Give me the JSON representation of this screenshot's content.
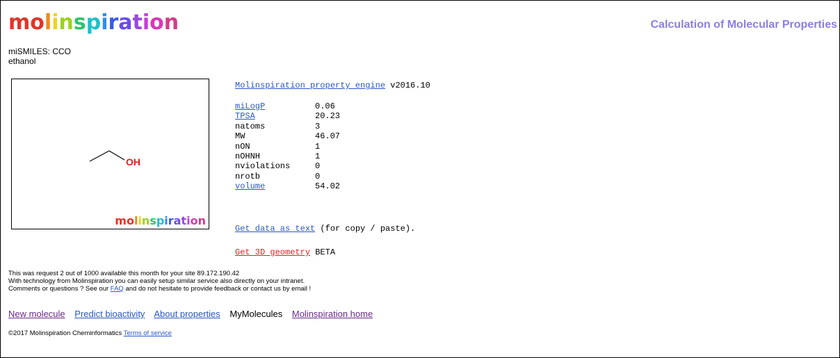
{
  "header": {
    "logo_letters": [
      {
        "ch": "m",
        "color": "#e0352b"
      },
      {
        "ch": "o",
        "color": "#e0352b"
      },
      {
        "ch": "l",
        "color": "#f08a1c"
      },
      {
        "ch": "i",
        "color": "#f2d21a"
      },
      {
        "ch": "n",
        "color": "#9bd31d"
      },
      {
        "ch": "s",
        "color": "#2fc46a"
      },
      {
        "ch": "p",
        "color": "#1fc0c8"
      },
      {
        "ch": "i",
        "color": "#2f8ee6"
      },
      {
        "ch": "r",
        "color": "#3b5be8"
      },
      {
        "ch": "a",
        "color": "#6a4be6"
      },
      {
        "ch": "t",
        "color": "#9a46e0"
      },
      {
        "ch": "i",
        "color": "#c43fd8"
      },
      {
        "ch": "o",
        "color": "#d838b8"
      },
      {
        "ch": "n",
        "color": "#d63a8a"
      }
    ],
    "page_heading": "Calculation of Molecular Properties",
    "heading_color": "#8a7fe6"
  },
  "molecule": {
    "smiles_line": "miSMILES: CCO",
    "name": "ethanol",
    "atom_label": "OH",
    "atom_color": "#e02020",
    "watermark": "molinspiration"
  },
  "engine": {
    "link": "Molinspiration property engine",
    "version": "v2016.10"
  },
  "properties": [
    {
      "name": "miLogP",
      "value": "0.06",
      "link": true
    },
    {
      "name": "TPSA",
      "value": "20.23",
      "link": true
    },
    {
      "name": "natoms",
      "value": "3",
      "link": false
    },
    {
      "name": "MW",
      "value": "46.07",
      "link": false
    },
    {
      "name": "nON",
      "value": "1",
      "link": false
    },
    {
      "name": "nOHNH",
      "value": "1",
      "link": false
    },
    {
      "name": "nviolations",
      "value": "0",
      "link": false
    },
    {
      "name": "nrotb",
      "value": "0",
      "link": false
    },
    {
      "name": "volume",
      "value": "54.02",
      "link": true
    }
  ],
  "actions": {
    "text_link": "Get data as text",
    "text_suffix": " (for copy / paste).",
    "geom_link": "Get 3D geometry",
    "geom_suffix": " BETA"
  },
  "info": {
    "line1": "This was request 2 out of 1000 available this month for your site 89.172.190.42",
    "line2": "With technology from Molinspiration you can easily setup similar service also directly on your intranet.",
    "line3_pre": "Comments or questions ? See our ",
    "line3_link": "FAQ",
    "line3_post": " and do not hesitate to provide feedback or contact us by email !"
  },
  "footer_nav": {
    "new_molecule": "New molecule",
    "predict": "Predict bioactivity",
    "about": "About properties",
    "mymolecules": "MyMolecules",
    "home": "Molinspiration home"
  },
  "copyright": {
    "text": "©2017 Molinspiration Cheminformatics ",
    "terms": "Terms of service"
  }
}
